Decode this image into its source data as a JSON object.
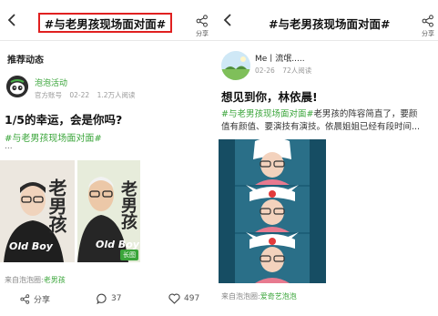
{
  "left": {
    "title": "#与老男孩现场面对面#",
    "share_label": "分享",
    "section_title": "推荐动态",
    "author": {
      "name": "泡泡活动",
      "badge": "官方账号",
      "date": "02-22",
      "reads": "1.2万人阅读"
    },
    "post_title": "1/5的幸运，会是你吗?",
    "hashtag": "#与老男孩现场面对面#",
    "ellipsis": "...",
    "image": {
      "left_text": "老男孩",
      "left_brand": "Old Boy",
      "right_text": "老男孩",
      "right_brand": "Old Boy",
      "multi_badge": "长图"
    },
    "from_prefix": "来自泡泡圈:",
    "from_circle": "老男孩",
    "actions": {
      "share_label": "分享",
      "comment_count": "37",
      "like_count": "497"
    }
  },
  "right": {
    "title": "#与老男孩现场面对面#",
    "share_label": "分享",
    "author": {
      "name": "Me丨流氓.....",
      "date": "02-26",
      "reads": "72人阅读"
    },
    "post_title": "想见到你，林依晨!",
    "hashtag": "#与老男孩现场面对面#",
    "body_line1": "老男孩的阵容简直了，要颜",
    "body_line2": "值有颜值、要演技有演技。依晨姐姐已经有段时间...",
    "from_prefix": "来自泡泡圈:",
    "from_circle": "爱奇艺泡泡"
  },
  "colors": {
    "accent_green": "#3aa53a",
    "highlight_red": "#e02020"
  },
  "icons": [
    "back-arrow-icon",
    "share-icon",
    "comment-icon",
    "like-heart-icon"
  ]
}
